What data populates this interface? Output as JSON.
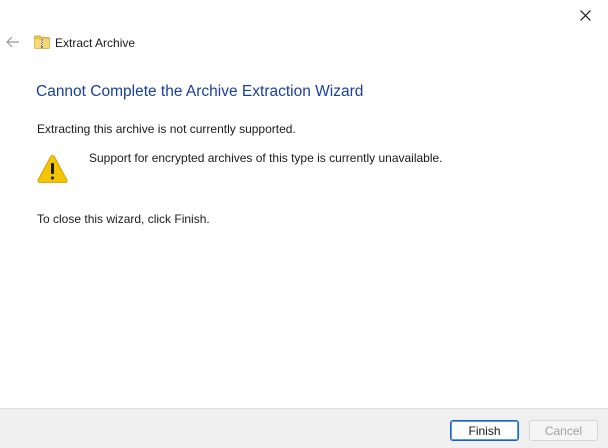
{
  "window": {
    "title": "Extract Archive",
    "close_icon": "close-icon",
    "back_icon": "back-arrow-icon",
    "folder_icon": "zip-folder-icon"
  },
  "main": {
    "heading": "Cannot Complete the Archive Extraction Wizard",
    "description": "Extracting this archive is not currently supported.",
    "warning_icon": "warning-icon",
    "warning_message": "Support for encrypted archives of this type is currently unavailable.",
    "close_instruction": "To close this wizard, click Finish."
  },
  "footer": {
    "finish_label": "Finish",
    "cancel_label": "Cancel",
    "cancel_enabled": false
  },
  "colors": {
    "heading": "#1a3f9e",
    "warning_fill": "#f5c400",
    "footer_bg": "#f0f0f0",
    "default_button_border": "#1c5fc4"
  }
}
